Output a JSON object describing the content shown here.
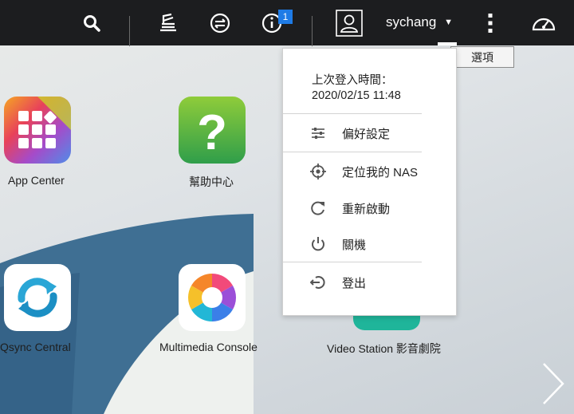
{
  "topbar": {
    "icons": [
      "search-icon",
      "stack-icon",
      "sync-icon",
      "info-icon",
      "user-icon",
      "more-icon",
      "dashboard-icon"
    ],
    "notification_count": "1",
    "username": "sychang",
    "tooltip": "選項"
  },
  "apps": [
    {
      "label": "App Center",
      "icon": "app-center-icon"
    },
    {
      "label": "幫助中心",
      "icon": "help-center-icon"
    },
    {
      "label": "Qsync Central",
      "icon": "qsync-icon"
    },
    {
      "label": "Multimedia Console",
      "icon": "multimedia-console-icon"
    },
    {
      "label": "Video Station 影音劇院",
      "icon": "video-station-icon"
    }
  ],
  "menu": {
    "last_login_label": "上次登入時間：",
    "last_login_time": "2020/02/15 11:48",
    "items": [
      {
        "label": "偏好設定",
        "icon": "sliders-icon"
      },
      {
        "label": "定位我的 NAS",
        "icon": "crosshair-icon"
      },
      {
        "label": "重新啟動",
        "icon": "restart-icon"
      },
      {
        "label": "關機",
        "icon": "power-icon"
      },
      {
        "label": "登出",
        "icon": "logout-icon"
      }
    ]
  },
  "colors": {
    "topbar": "#1c1d1f",
    "badge": "#1e7be6",
    "background": "#dfe3e6"
  }
}
